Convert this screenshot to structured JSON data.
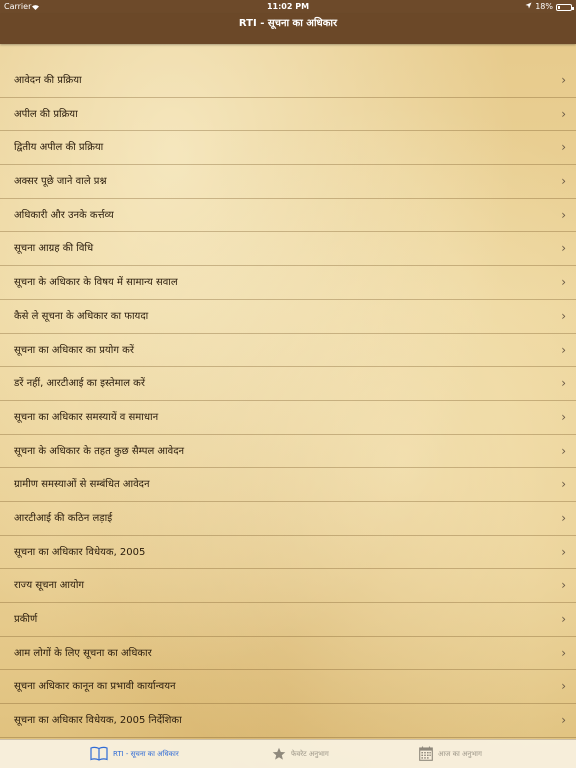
{
  "status": {
    "carrier": "Carrier",
    "time": "11:02 PM",
    "battery_text": "18%",
    "battery_level": 0.18
  },
  "nav": {
    "title": "RTI - सूचना का अधिकार"
  },
  "menu": {
    "items": [
      {
        "label": "आवेदन की प्रक्रिया"
      },
      {
        "label": "अपील की प्रक्रिया"
      },
      {
        "label": "द्वितीय अपील की प्रक्रिया"
      },
      {
        "label": "अक्सर पूछे जाने वाले प्रश्न"
      },
      {
        "label": "अधिकारी और उनके कर्त्तव्य"
      },
      {
        "label": "सूचना आग्रह की विधि"
      },
      {
        "label": "सूचना के अधिकार के विषय में सामान्य सवाल"
      },
      {
        "label": "कैसे ले सूचना के अधिकार का फायदा"
      },
      {
        "label": "सूचना का अधिकार का प्रयोग करें"
      },
      {
        "label": "डरें नहीं, आरटीआई का इस्तेमाल करें"
      },
      {
        "label": "सूचना का अधिकार समस्यायें व समाधान"
      },
      {
        "label": "सूचना के अधिकार के तहत कुछ सैम्पल आवेदन"
      },
      {
        "label": "ग्रामीण समस्याओं से सम्बंधित आवेदन"
      },
      {
        "label": "आरटीआई की कठिन लड़ाई"
      },
      {
        "label": "सूचना का अधिकार विधेयक, 2005"
      },
      {
        "label": "राज्य सूचना आयोग"
      },
      {
        "label": "प्रकीर्ण"
      },
      {
        "label": "आम लोगों के लिए सूचना का अधिकार"
      },
      {
        "label": "सूचना अधिकार कानून का प्रभावी कार्यान्वयन"
      },
      {
        "label": "सूचना का अधिकार विधेयक, 2005 निर्देशिका"
      }
    ]
  },
  "tabs": [
    {
      "label": "RTI - सूचना का अधिकार",
      "icon": "book-icon",
      "active": true
    },
    {
      "label": "फेवरेट अनुभाग",
      "icon": "star-icon",
      "active": false
    },
    {
      "label": "आज का अनुभाग",
      "icon": "calendar-icon",
      "active": false
    }
  ],
  "colors": {
    "nav_background": "#6b4828",
    "active_tab": "#2f6bd6",
    "inactive_tab": "#9a9486"
  }
}
